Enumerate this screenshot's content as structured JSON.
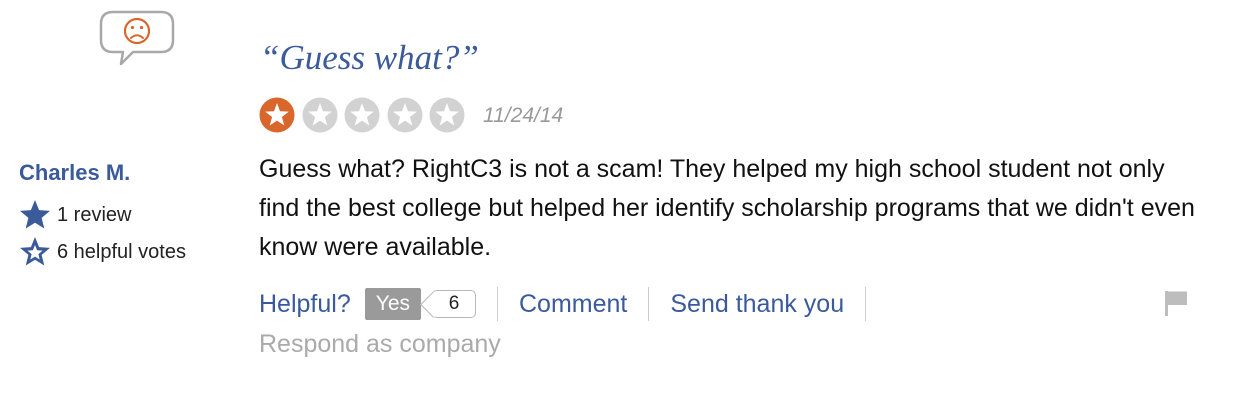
{
  "reviewer": {
    "name": "Charles M.",
    "reviews_text": "1 review",
    "votes_text": "6 helpful votes",
    "sentiment_icon": "frown-face-icon"
  },
  "review": {
    "title": "“Guess what?”",
    "rating": 1,
    "rating_max": 5,
    "date": "11/24/14",
    "body": "Guess what? RightC3 is not a scam! They helped my high school student not only find the best college but helped her identify scholarship programs that we didn't even know were available."
  },
  "actions": {
    "helpful_label": "Helpful?",
    "yes_label": "Yes",
    "helpful_count": "6",
    "comment_label": "Comment",
    "thank_label": "Send thank you",
    "respond_label": "Respond as company",
    "flag_icon": "flag-icon"
  },
  "colors": {
    "brand_blue": "#3a5a9a",
    "rating_orange": "#d9662b",
    "empty_star": "#d2d2d2",
    "muted": "#aaaaaa"
  }
}
